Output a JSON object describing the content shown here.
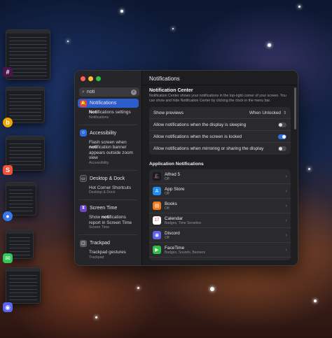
{
  "window": {
    "title": "Notifications",
    "traffic_colors": [
      "#ff5f57",
      "#febc2e",
      "#28c840"
    ]
  },
  "search": {
    "value": "noti",
    "icon": "search-icon"
  },
  "results": [
    {
      "title": "Notifications",
      "icon": "bell-badge-icon",
      "color": "#e0443e",
      "selected": true,
      "sub": [
        {
          "text": "Notifications settings",
          "path": "Notifications"
        }
      ]
    },
    {
      "title": "Accessibility",
      "icon": "accessibility-icon",
      "color": "#2d6be0",
      "selected": false,
      "sub": [
        {
          "text": "Flash screen when notification banner appears outside zoom view",
          "path": "Accessibility"
        }
      ]
    },
    {
      "title": "Desktop & Dock",
      "icon": "dock-icon",
      "color": "#3a3a3e",
      "selected": false,
      "sub": [
        {
          "text": "Hot Corner Shortcuts",
          "path": "Desktop & Dock"
        }
      ]
    },
    {
      "title": "Screen Time",
      "icon": "hourglass-icon",
      "color": "#6b48c8",
      "selected": false,
      "sub": [
        {
          "text": "Show notifications report in Screen Time",
          "path": "Screen Time"
        }
      ]
    },
    {
      "title": "Trackpad",
      "icon": "trackpad-icon",
      "color": "#5b5b60",
      "selected": false,
      "sub": [
        {
          "text": "Trackpad gestures",
          "path": "Trackpad"
        }
      ]
    }
  ],
  "notification_center": {
    "title": "Notification Center",
    "description": "Notification Center shows your notifications in the top-right corner of your screen. You can show and hide Notification Center by clicking the clock in the menu bar."
  },
  "settings": {
    "show_previews_label": "Show previews",
    "show_previews_value": "When Unlocked",
    "toggles": [
      {
        "label": "Allow notifications when the display is sleeping",
        "on": false
      },
      {
        "label": "Allow notifications when the screen is locked",
        "on": true
      },
      {
        "label": "Allow notifications when mirroring or sharing the display",
        "on": false
      }
    ]
  },
  "app_notifications": {
    "title": "Application Notifications",
    "apps": [
      {
        "name": "Alfred 5",
        "status": "Off",
        "icon": "alfred-icon",
        "color": "#1a1a1a"
      },
      {
        "name": "App Store",
        "status": "Off",
        "icon": "app-store-icon",
        "color": "#1f8ef1"
      },
      {
        "name": "Books",
        "status": "Off",
        "icon": "books-icon",
        "color": "#f07b1a"
      },
      {
        "name": "Calendar",
        "status": "Badges, Time Sensitive",
        "icon": "calendar-icon",
        "color": "#ffffff"
      },
      {
        "name": "Discord",
        "status": "Off",
        "icon": "discord-icon",
        "color": "#5865f2"
      },
      {
        "name": "FaceTime",
        "status": "Badges, Sounds, Banners",
        "icon": "facetime-icon",
        "color": "#2fbf4a"
      }
    ]
  },
  "stage_apps": [
    {
      "icon": "slack-icon",
      "color": "#4a154b"
    },
    {
      "icon": "bezel-icon",
      "color": "#f0a400"
    },
    {
      "icon": "swift-icon",
      "color": "#f05138"
    },
    {
      "icon": "signal-icon",
      "color": "#3a76f0"
    },
    {
      "icon": "messages-icon",
      "color": "#34c759"
    },
    {
      "icon": "discord-icon",
      "color": "#5865f2"
    }
  ]
}
